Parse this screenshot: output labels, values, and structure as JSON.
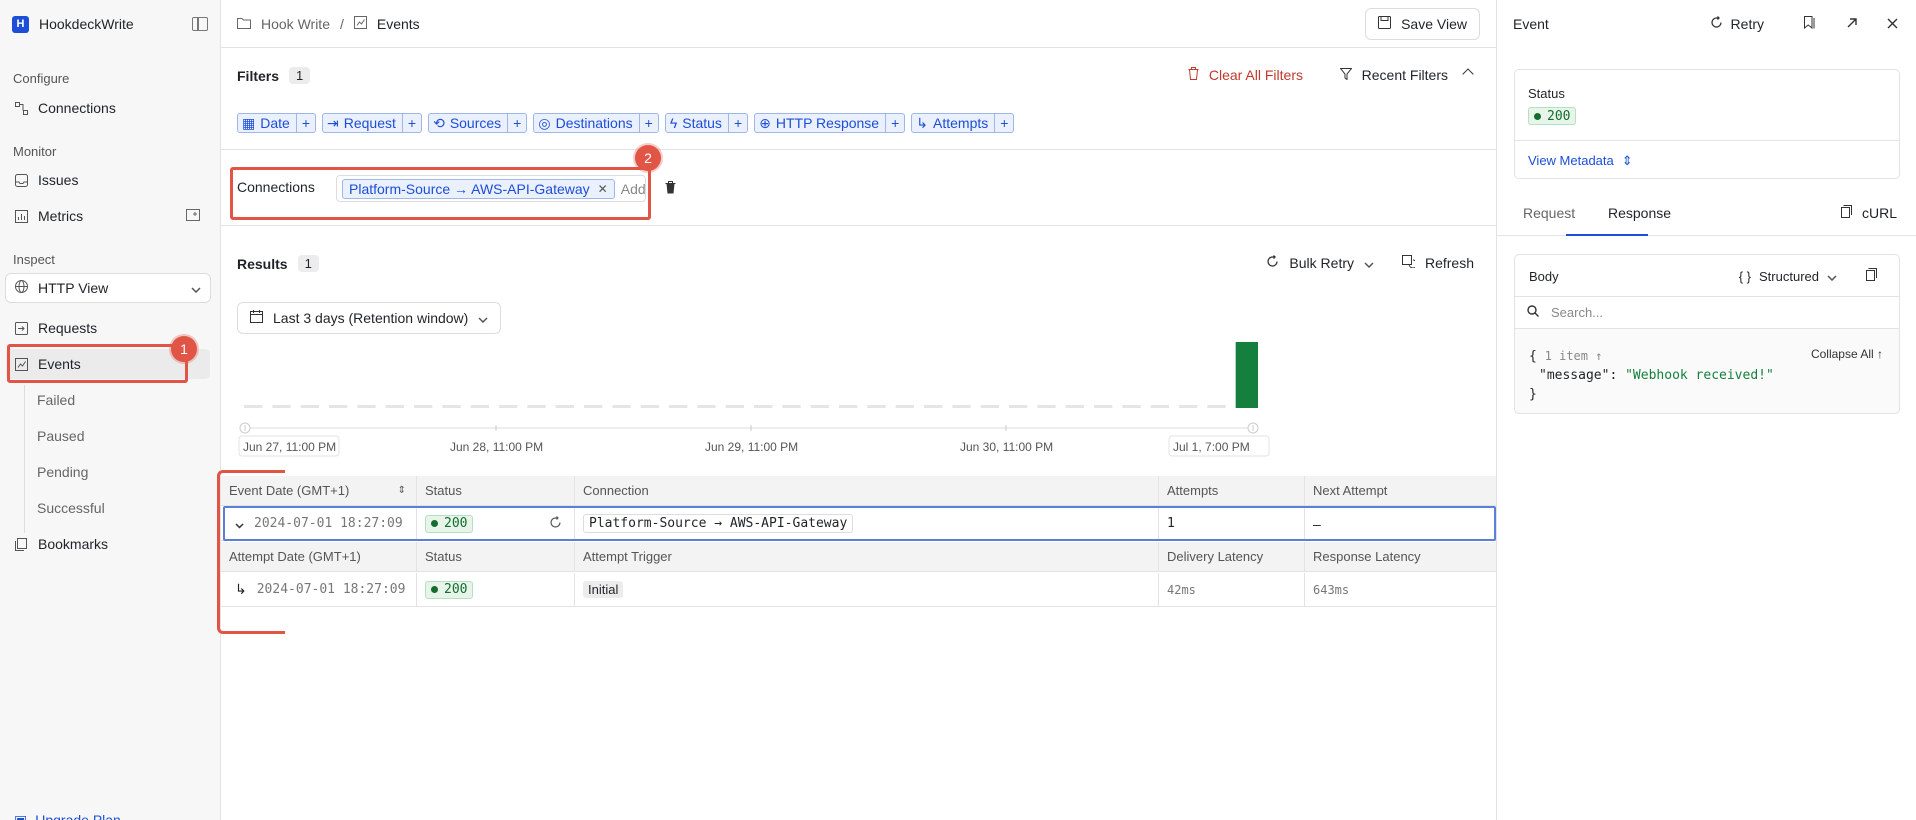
{
  "sidebar": {
    "brand": {
      "logo": "H",
      "name": "HookdeckWrite"
    },
    "sections": {
      "configure": "Configure",
      "monitor": "Monitor",
      "inspect": "Inspect"
    },
    "items": {
      "connections": "Connections",
      "issues": "Issues",
      "metrics": "Metrics",
      "http_view": "HTTP View",
      "requests": "Requests",
      "events": "Events",
      "failed": "Failed",
      "paused": "Paused",
      "pending": "Pending",
      "successful": "Successful",
      "bookmarks": "Bookmarks",
      "upgrade": "Upgrade Plan"
    }
  },
  "header": {
    "breadcrumb": [
      "Hook Write",
      "Events"
    ],
    "save_view": "Save View"
  },
  "filters": {
    "title": "Filters",
    "count": "1",
    "clear_all": "Clear All Filters",
    "recent": "Recent Filters",
    "chips": [
      "Date",
      "Request",
      "Sources",
      "Destinations",
      "Status",
      "HTTP Response",
      "Attempts"
    ],
    "connections_label": "Connections",
    "connection_tag": "Platform-Source → AWS-API-Gateway",
    "add_placeholder": "Add"
  },
  "annotations": {
    "one": "1",
    "two": "2"
  },
  "results": {
    "title": "Results",
    "count": "1",
    "bulk_retry": "Bulk Retry",
    "refresh": "Refresh",
    "date_range": "Last 3 days (Retention window)"
  },
  "chart_data": {
    "type": "bar",
    "x_ticks": [
      "Jun 27, 11:00 PM",
      "Jun 28, 11:00 PM",
      "Jun 29, 11:00 PM",
      "Jun 30, 11:00 PM",
      "Jul 1, 7:00 PM"
    ],
    "bucket_count": 36,
    "values_last_bucket": 1,
    "bar_color": "#15803d",
    "empty_color": "#e5e5e5"
  },
  "table": {
    "event_headers": [
      "Event Date (GMT+1)",
      "Status",
      "Connection",
      "Attempts",
      "Next Attempt"
    ],
    "event_row": {
      "date": "2024-07-01 18:27:09",
      "status": "200",
      "connection": "Platform-Source → AWS-API-Gateway",
      "attempts": "1",
      "next_attempt": "–"
    },
    "attempt_headers": [
      "Attempt Date (GMT+1)",
      "Status",
      "Attempt Trigger",
      "Delivery Latency",
      "Response Latency"
    ],
    "attempt_row": {
      "date": "2024-07-01 18:27:09",
      "status": "200",
      "trigger": "Initial",
      "delivery_latency": "42ms",
      "response_latency": "643ms"
    }
  },
  "panel": {
    "title": "Event",
    "retry": "Retry",
    "status_label": "Status",
    "status_value": "200",
    "view_metadata": "View Metadata",
    "tabs": [
      "Request",
      "Response"
    ],
    "curl": "cURL",
    "body_title": "Body",
    "structured": "Structured",
    "search_placeholder": "Search...",
    "collapse_all": "Collapse All ↑",
    "json_meta": "1 item ↑",
    "json_key": "\"message\"",
    "json_value": "\"Webhook received!\""
  },
  "colors": {
    "accent": "#1d4ed8",
    "annotation": "#e05546",
    "success": "#15803d"
  }
}
